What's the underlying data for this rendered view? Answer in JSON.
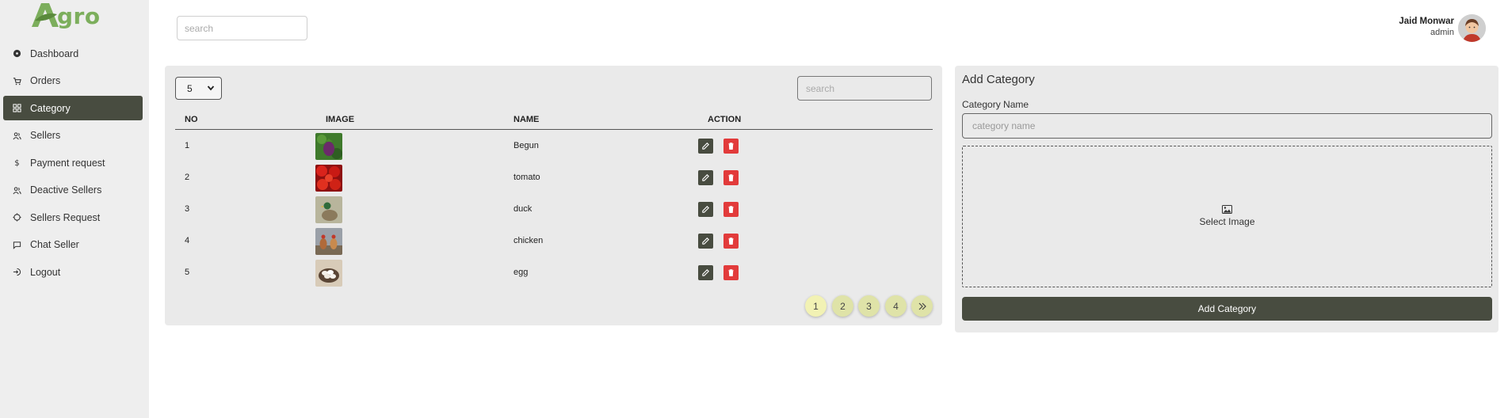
{
  "brand": {
    "name": "gro",
    "color": "#7cae5c"
  },
  "sidebar": {
    "items": [
      {
        "label": "Dashboard",
        "icon": "dashboard-icon"
      },
      {
        "label": "Orders",
        "icon": "cart-icon"
      },
      {
        "label": "Category",
        "icon": "grid-icon",
        "active": true
      },
      {
        "label": "Sellers",
        "icon": "users-icon"
      },
      {
        "label": "Payment request",
        "icon": "dollar-icon"
      },
      {
        "label": "Deactive Sellers",
        "icon": "users-icon"
      },
      {
        "label": "Sellers Request",
        "icon": "loader-icon"
      },
      {
        "label": "Chat Seller",
        "icon": "chat-icon"
      },
      {
        "label": "Logout",
        "icon": "logout-icon"
      }
    ]
  },
  "header": {
    "search_placeholder": "search",
    "user": {
      "name": "Jaid Monwar",
      "role": "admin"
    }
  },
  "list": {
    "page_size": "5",
    "search_placeholder": "search",
    "columns": [
      "NO",
      "IMAGE",
      "NAME",
      "ACTION"
    ],
    "rows": [
      {
        "no": "1",
        "name": "Begun"
      },
      {
        "no": "2",
        "name": "tomato"
      },
      {
        "no": "3",
        "name": "duck"
      },
      {
        "no": "4",
        "name": "chicken"
      },
      {
        "no": "5",
        "name": "egg"
      }
    ],
    "pages": [
      "1",
      "2",
      "3",
      "4"
    ],
    "current_page": "1"
  },
  "add_category": {
    "title": "Add Category",
    "field_label": "Category Name",
    "field_placeholder": "category name",
    "select_image_label": "Select Image",
    "submit_label": "Add Category"
  },
  "colors": {
    "accent_dark": "#484c40",
    "delete": "#e23b3b",
    "pager": "#dfe3a8",
    "panel": "#eaeaea",
    "sidebar": "#eeeeee"
  }
}
